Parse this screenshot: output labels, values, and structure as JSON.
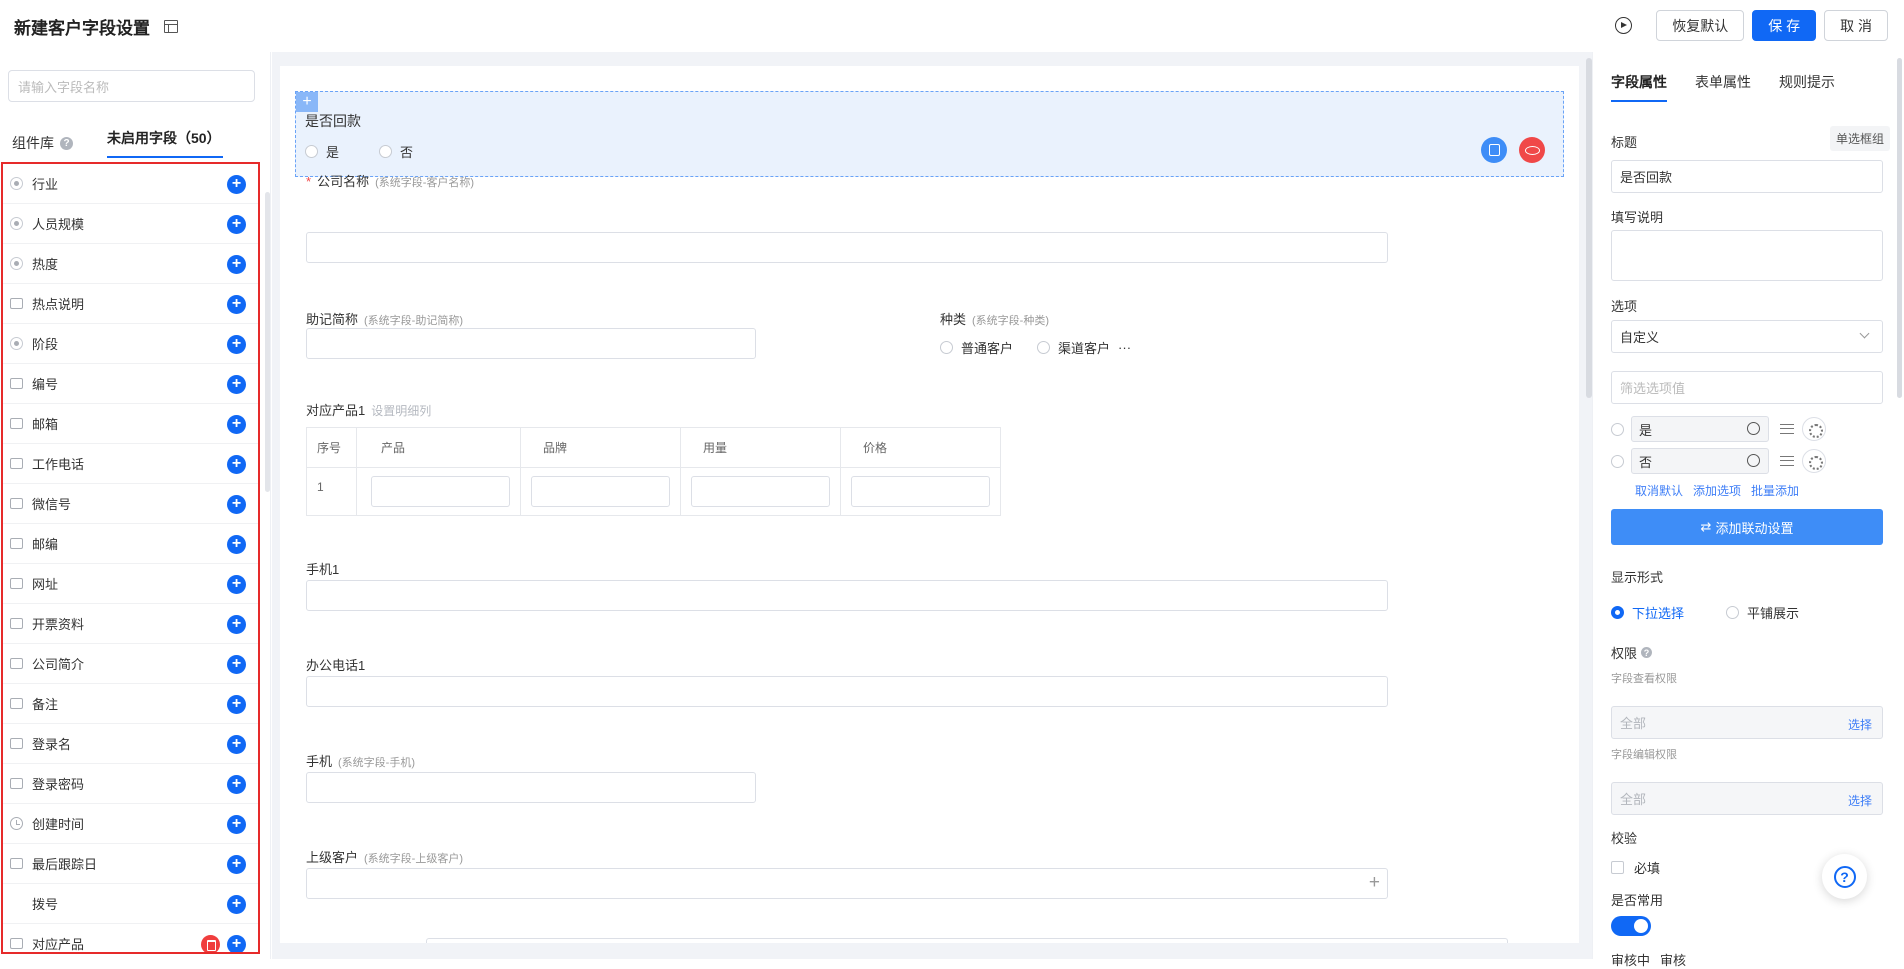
{
  "header": {
    "title": "新建客户字段设置",
    "restore_label": "恢复默认",
    "save_label": "保 存",
    "cancel_label": "取 消"
  },
  "left": {
    "search_placeholder": "请输入字段名称",
    "tab_library": "组件库",
    "tab_disabled": "未启用字段（50）",
    "fields": [
      {
        "label": "行业",
        "icon": "radio-icon"
      },
      {
        "label": "人员规模",
        "icon": "radio-icon"
      },
      {
        "label": "热度",
        "icon": "radio-icon"
      },
      {
        "label": "热点说明",
        "icon": "text-input-icon"
      },
      {
        "label": "阶段",
        "icon": "radio-icon"
      },
      {
        "label": "编号",
        "icon": "number-icon"
      },
      {
        "label": "邮箱",
        "icon": "text-input-icon"
      },
      {
        "label": "工作电话",
        "icon": "text-input-icon"
      },
      {
        "label": "微信号",
        "icon": "text-input-icon"
      },
      {
        "label": "邮编",
        "icon": "text-input-icon"
      },
      {
        "label": "网址",
        "icon": "text-input-icon"
      },
      {
        "label": "开票资料",
        "icon": "textarea-icon"
      },
      {
        "label": "公司简介",
        "icon": "textarea-icon"
      },
      {
        "label": "备注",
        "icon": "image-icon"
      },
      {
        "label": "登录名",
        "icon": "text-input-icon"
      },
      {
        "label": "登录密码",
        "icon": "text-input-icon"
      },
      {
        "label": "创建时间",
        "icon": "clock-icon"
      },
      {
        "label": "最后跟踪日",
        "icon": "calendar-icon"
      },
      {
        "label": "拨号",
        "icon": "none"
      },
      {
        "label": "对应产品",
        "icon": "table-icon"
      }
    ]
  },
  "canvas": {
    "selected": {
      "title": "是否回款",
      "options": [
        "是",
        "否"
      ]
    },
    "company": {
      "label": "公司名称",
      "note": "(系统字段-客户名称)",
      "required_mark": "*"
    },
    "alias": {
      "label": "助记简称",
      "note": "(系统字段-助记简称)"
    },
    "category": {
      "label": "种类",
      "note": "(系统字段-种类)",
      "options": [
        "普通客户",
        "渠道客户"
      ],
      "more": "···"
    },
    "product": {
      "label": "对应产品1",
      "link": "设置明细列",
      "headers": [
        "序号",
        "产品",
        "品牌",
        "用量",
        "价格"
      ],
      "row_index": "1"
    },
    "mobile1": {
      "label": "手机1"
    },
    "office1": {
      "label": "办公电话1"
    },
    "mobile": {
      "label": "手机",
      "note": "(系统字段-手机)"
    },
    "parent": {
      "label": "上级客户",
      "note": "(系统字段-上级客户)",
      "plus": "+"
    }
  },
  "right": {
    "tabs": [
      "字段属性",
      "表单属性",
      "规则提示"
    ],
    "title_label": "标题",
    "title_badge": "单选框组",
    "title_value": "是否回款",
    "desc_label": "填写说明",
    "options_label": "选项",
    "options_select": "自定义",
    "filter_placeholder": "筛选选项值",
    "option_values": [
      "是",
      "否"
    ],
    "links": [
      "取消默认",
      "添加选项",
      "批量添加"
    ],
    "link_button": "添加联动设置",
    "display_label": "显示形式",
    "display_options": [
      "下拉选择",
      "平铺展示"
    ],
    "perm_label": "权限",
    "view_perm_label": "字段查看权限",
    "view_perm_value": "全部",
    "edit_perm_label": "字段编辑权限",
    "edit_perm_value": "全部",
    "select_link": "选择",
    "validate_label": "校验",
    "required_label": "必填",
    "common_label": "是否常用",
    "cut_texts": [
      "审核中",
      "审核"
    ]
  }
}
